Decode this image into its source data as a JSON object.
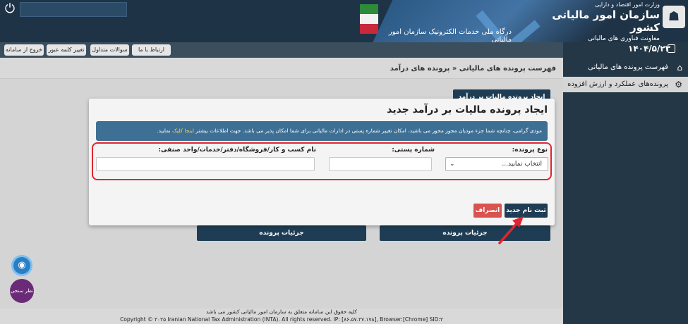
{
  "header": {
    "portal_title": "درگاه ملی خدمات الکترونیک سازمان امور مالیاتی",
    "org_line1": "وزارت امور اقتصاد و دارایی",
    "org_name": "سازمان امور مالیاتی کشور",
    "org_line3": "معاونت فناوری های مالیاتی",
    "power_icon": "⏻",
    "logo_icon": "☗"
  },
  "toolbar": {
    "exit": "خروج از سامانه",
    "change_password": "تغییر کلمه عبور",
    "faq": "سوالات متداول",
    "contact": "ارتباط با ما"
  },
  "sidebar": {
    "date": "۱۴۰۴/۵/۲۳",
    "items": [
      {
        "label": "فهرست پرونده های مالیاتی",
        "icon": "⌂"
      },
      {
        "label": "پرونده‌های عملکرد و ارزش افزوده",
        "icon": "⚙"
      }
    ]
  },
  "breadcrumb": {
    "parent": "فهرست پرونده های مالیاتی",
    "separator": "«",
    "current": "پرونده های درآمد"
  },
  "background": {
    "create_button": "ایجاد پرونده مالیات بر درآمد جدید",
    "details_button_1": "جزئیات پرونده",
    "details_button_2": "جزئیات پرونده"
  },
  "modal": {
    "title": "ایجاد پرونده مالیات بر درآمد جدید",
    "info_text": "مودی گرامی، چنانچه شما جزء مودیان مجوز محور می باشید، امکان تغییر شماره پستی در ادارات مالیاتی برای شما امکان پذیر می باشد. جهت اطلاعات بیشتر",
    "info_link": "اینجا کلیک",
    "info_tail": "نمایید.",
    "file_type_label": "نوع پرونده:",
    "file_type_value": "انتخاب نمایید...",
    "postal_label": "شماره پستی:",
    "postal_value": "",
    "business_label": "نام کسب و کار/فروشگاه/دفتر/خدمات/واحد صنفی:",
    "business_value": "",
    "register_button": "ثبت نام جدید",
    "cancel_button": "انصراف"
  },
  "floating": {
    "survey_label": "نظر سنجی",
    "accessibility_icon": "◉"
  },
  "footer": {
    "rights_fa": "کلیه حقوق این سامانه متعلق به سازمان امور مالیاتی کشور می باشد",
    "copyright": "Copyright © ۲۰۲۵ Iranian National Tax Administration (INTA). All rights reserved. IP: [۸۶.۵۷.۲۷.۱۷۸], Browser:[Chrome] SID:۲"
  }
}
